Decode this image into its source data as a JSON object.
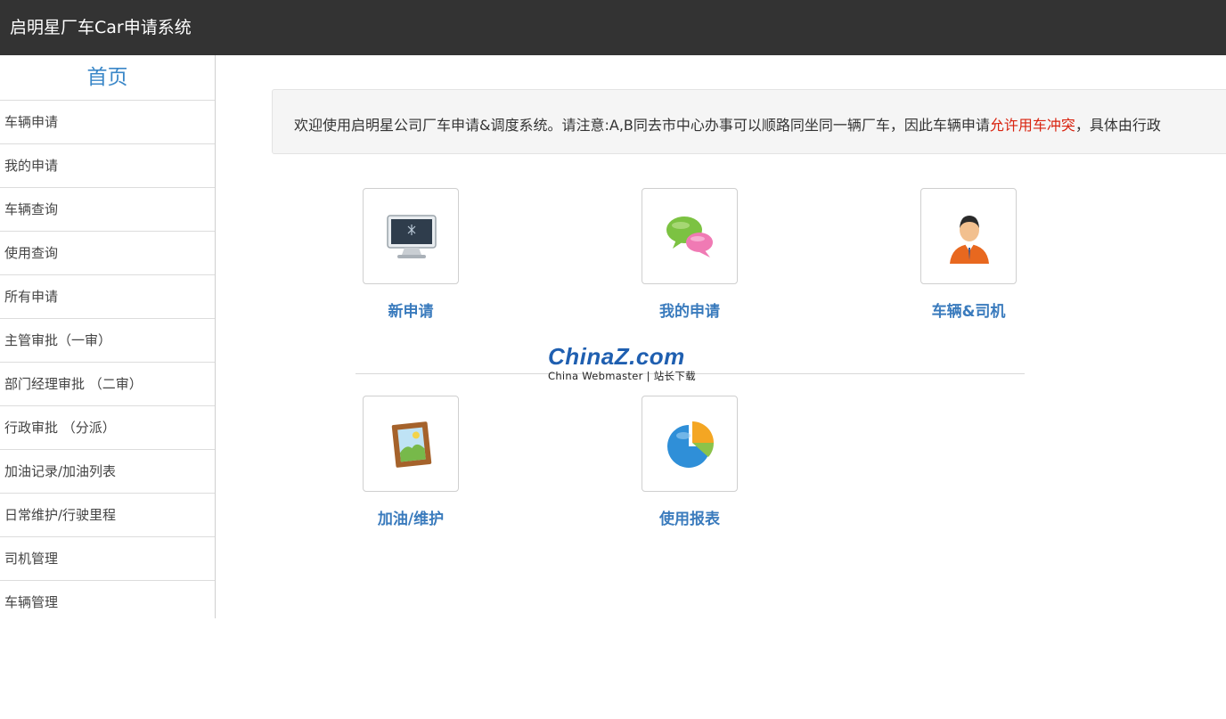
{
  "header": {
    "title": "启明星厂车Car申请系统"
  },
  "sidebar": {
    "home": "首页",
    "items": [
      {
        "label": "车辆申请"
      },
      {
        "label": "我的申请"
      },
      {
        "label": "车辆查询"
      },
      {
        "label": "使用查询"
      },
      {
        "label": "所有申请"
      },
      {
        "label": "主管审批（一审）"
      },
      {
        "label": "部门经理审批 （二审）"
      },
      {
        "label": "行政审批 （分派）"
      },
      {
        "label": "加油记录/加油列表"
      },
      {
        "label": "日常维护/行驶里程"
      },
      {
        "label": "司机管理"
      },
      {
        "label": "车辆管理"
      }
    ]
  },
  "notice": {
    "before": "欢迎使用启明星公司厂车申请&调度系统。请注意:A,B同去市中心办事可以顺路同坐同一辆厂车，因此车辆申请",
    "highlight": "允许用车冲突",
    "after": "，具体由行政"
  },
  "tiles": [
    {
      "label": "新申请",
      "icon": "monitor-icon"
    },
    {
      "label": "我的申请",
      "icon": "chat-bubbles-icon"
    },
    {
      "label": "车辆&司机",
      "icon": "person-icon"
    },
    {
      "label": "加油/维护",
      "icon": "picture-frame-icon"
    },
    {
      "label": "使用报表",
      "icon": "pie-chart-icon"
    }
  ],
  "watermark": {
    "logo": "ChinaZ.com",
    "sub": "China Webmaster | 站长下载"
  },
  "colors": {
    "header_bg": "#333333",
    "accent": "#3a7bbd",
    "highlight": "#d9230f"
  }
}
